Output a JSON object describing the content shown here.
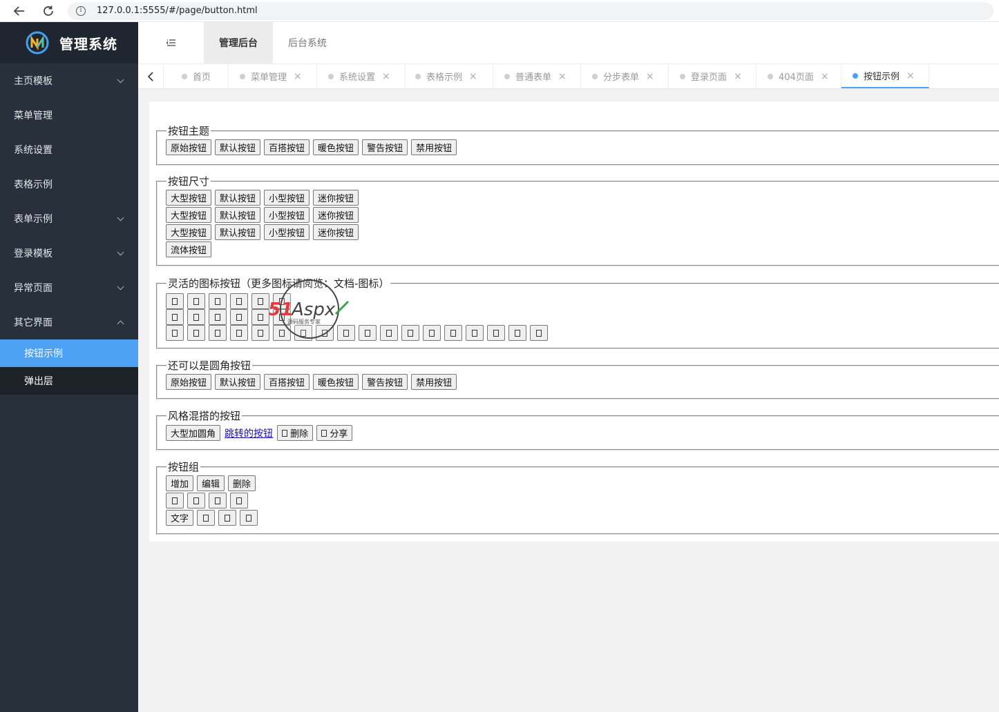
{
  "browser": {
    "url": "127.0.0.1:5555/#/page/button.html"
  },
  "sidebar": {
    "title": "管理系统",
    "items": [
      {
        "label": "主页模板",
        "expandable": true
      },
      {
        "label": "菜单管理"
      },
      {
        "label": "系统设置"
      },
      {
        "label": "表格示例"
      },
      {
        "label": "表单示例",
        "expandable": true
      },
      {
        "label": "登录模板",
        "expandable": true
      },
      {
        "label": "异常页面",
        "expandable": true
      },
      {
        "label": "其它界面",
        "expandable": true,
        "expanded": true
      }
    ],
    "subitems": [
      {
        "label": "按钮示例",
        "active": true
      },
      {
        "label": "弹出层"
      }
    ]
  },
  "header": {
    "tabs": [
      {
        "label": "管理后台",
        "active": true
      },
      {
        "label": "后台系统"
      }
    ]
  },
  "tabs": [
    {
      "label": "首页",
      "closable": false
    },
    {
      "label": "菜单管理"
    },
    {
      "label": "系统设置"
    },
    {
      "label": "表格示例"
    },
    {
      "label": "普通表单"
    },
    {
      "label": "分步表单"
    },
    {
      "label": "登录页面"
    },
    {
      "label": "404页面"
    },
    {
      "label": "按钮示例",
      "active": true
    }
  ],
  "sections": {
    "theme": {
      "legend": "按钮主题",
      "buttons": [
        "原始按钮",
        "默认按钮",
        "百搭按钮",
        "暖色按钮",
        "警告按钮",
        "禁用按钮"
      ]
    },
    "size": {
      "legend": "按钮尺寸",
      "rows": [
        [
          "大型按钮",
          "默认按钮",
          "小型按钮",
          "迷你按钮"
        ],
        [
          "大型按钮",
          "默认按钮",
          "小型按钮",
          "迷你按钮"
        ],
        [
          "大型按钮",
          "默认按钮",
          "小型按钮",
          "迷你按钮"
        ]
      ],
      "fluid": "流体按钮"
    },
    "icons": {
      "legend": "灵活的图标按钮（更多图标请阅览：文档-图标）",
      "rows": [
        6,
        6,
        18
      ]
    },
    "radius": {
      "legend": "还可以是圆角按钮",
      "buttons": [
        "原始按钮",
        "默认按钮",
        "百搭按钮",
        "暖色按钮",
        "警告按钮",
        "禁用按钮"
      ]
    },
    "mixed": {
      "legend": "风格混搭的按钮",
      "big_round": "大型加圆角",
      "link": "跳转的按钮",
      "delete": "删除",
      "share": "分享"
    },
    "group": {
      "legend": "按钮组",
      "row1": [
        "增加",
        "编辑",
        "删除"
      ],
      "row2_icons": 4,
      "row3_text": "文字",
      "row3_icons": 3
    }
  },
  "watermark": {
    "brand_a": "51",
    "brand_b": "Aspx",
    "tagline": "源码服务专家"
  }
}
